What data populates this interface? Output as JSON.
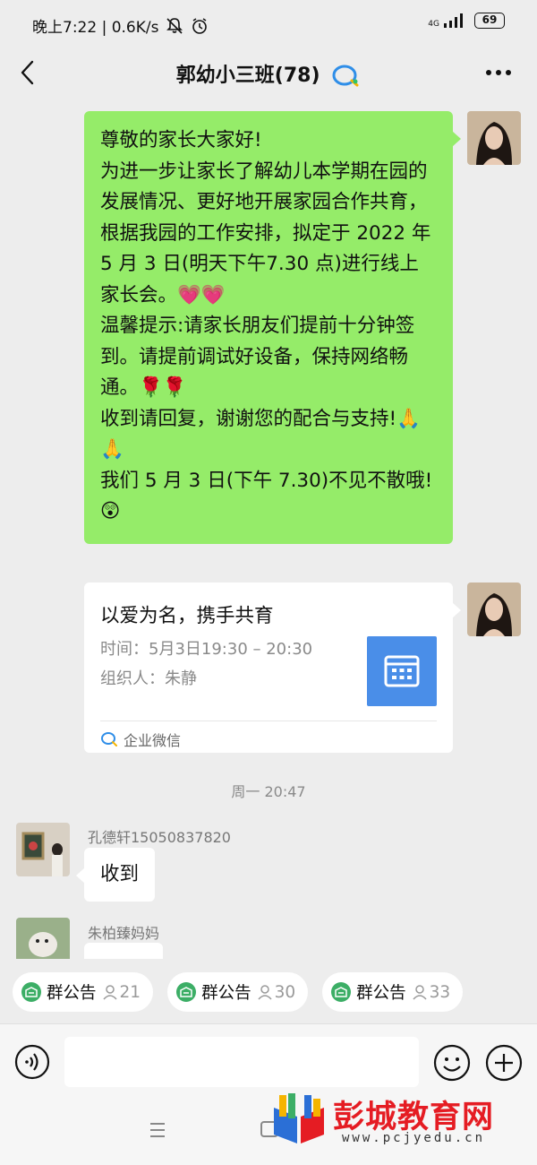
{
  "status_bar": {
    "time_speed": "晚上7:22 | 0.6K/s",
    "network": "4G",
    "battery": "69"
  },
  "header": {
    "title": "郭幼小三班(78)"
  },
  "messages": {
    "announcement_lines": [
      "尊敬的家长大家好!",
      "为进一步让家长了解幼儿本学期在园的发展情况、更好地开展家园合作共育，根据我园的工作安排，拟定于 2022 年 5 月 3 日(明天下午7.30 点)进行线上家长会。💗💗",
      "温馨提示:请家长朋友们提前十分钟签到。请提前调试好设备，保持网络畅通。🌹🌹",
      "收到请回复，谢谢您的配合与支持!🙏🙏",
      "我们 5 月 3 日(下午 7.30)不见不散哦!😲"
    ],
    "meeting_card": {
      "title": "以爱为名，携手共育",
      "time": "时间：5月3日19:30 – 20:30",
      "organizer": "组织人：朱静",
      "source": "企业微信"
    },
    "time_divider": "周一 20:47",
    "reply1": {
      "sender": "孔德轩15050837820",
      "text": "收到"
    },
    "reply2": {
      "sender": "朱柏臻妈妈"
    }
  },
  "announce_bar": [
    {
      "label": "群公告",
      "count": "21"
    },
    {
      "label": "群公告",
      "count": "30"
    },
    {
      "label": "群公告",
      "count": "33"
    }
  ],
  "input": {
    "value": ""
  },
  "watermark": {
    "title": "彭城教育网",
    "url": "www.pcjyedu.cn"
  },
  "colors": {
    "green_bubble": "#95ec69",
    "calendar_blue": "#4a8ee8",
    "announce_green": "#3cae66",
    "watermark_red": "#e51c23"
  }
}
